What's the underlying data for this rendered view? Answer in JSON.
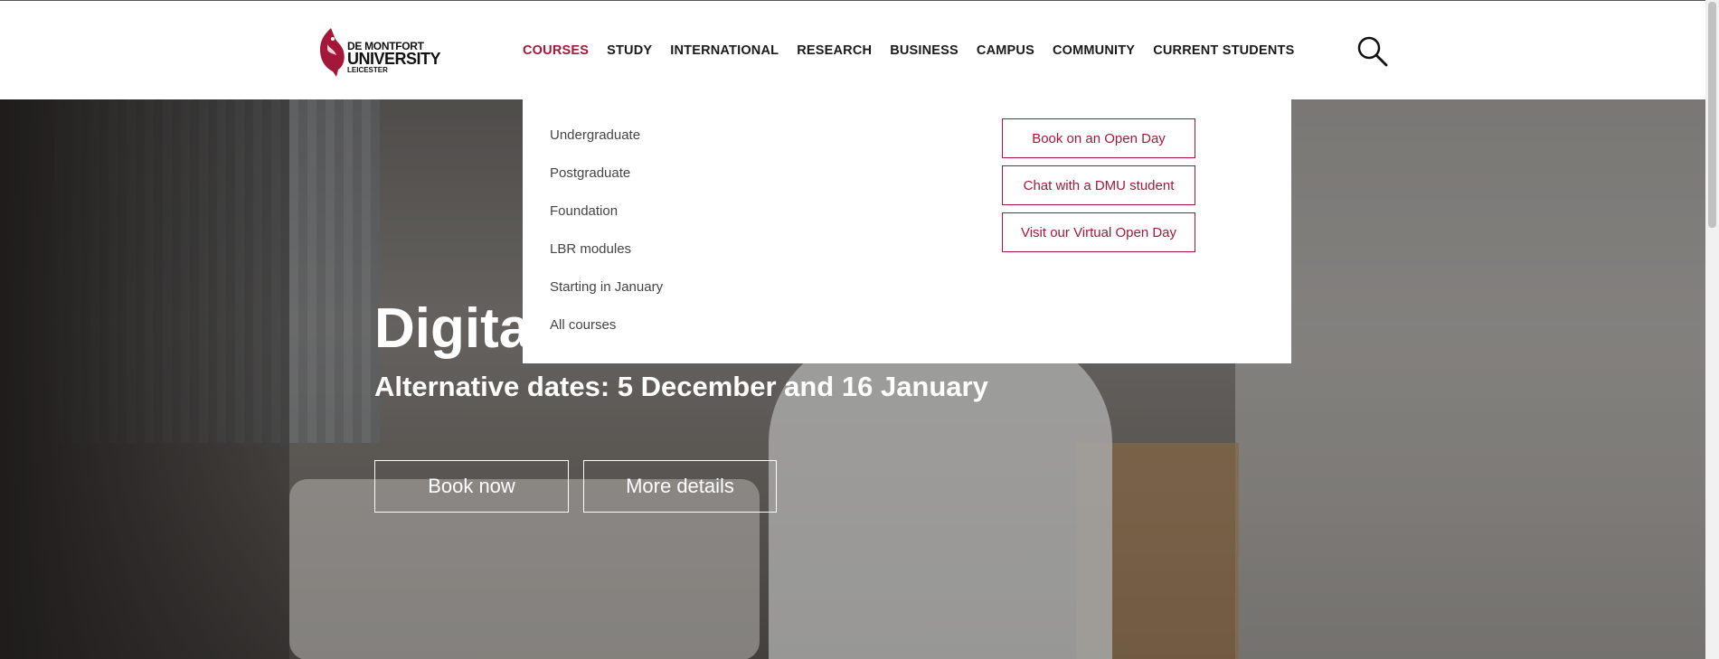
{
  "brand": {
    "logo_line1": "DE MONTFORT",
    "logo_line2": "UNIVERSITY",
    "logo_line3": "LEICESTER",
    "accent_color": "#a3183a"
  },
  "nav": {
    "items": [
      {
        "label": "COURSES",
        "active": true
      },
      {
        "label": "STUDY",
        "active": false
      },
      {
        "label": "INTERNATIONAL",
        "active": false
      },
      {
        "label": "RESEARCH",
        "active": false
      },
      {
        "label": "BUSINESS",
        "active": false
      },
      {
        "label": "CAMPUS",
        "active": false
      },
      {
        "label": "COMMUNITY",
        "active": false
      },
      {
        "label": "CURRENT STUDENTS",
        "active": false
      }
    ],
    "search_icon": "search-icon"
  },
  "dropdown": {
    "links": [
      "Undergraduate",
      "Postgraduate",
      "Foundation",
      "LBR modules",
      "Starting in January",
      "All courses"
    ],
    "ctas": [
      "Book on an Open Day",
      "Chat with a DMU student",
      "Visit our Virtual Open Day"
    ]
  },
  "hero": {
    "title": "Digital Open Day",
    "subtitle": "Alternative dates: 5 December and 16 January",
    "buttons": {
      "book": "Book now",
      "more": "More details"
    }
  }
}
